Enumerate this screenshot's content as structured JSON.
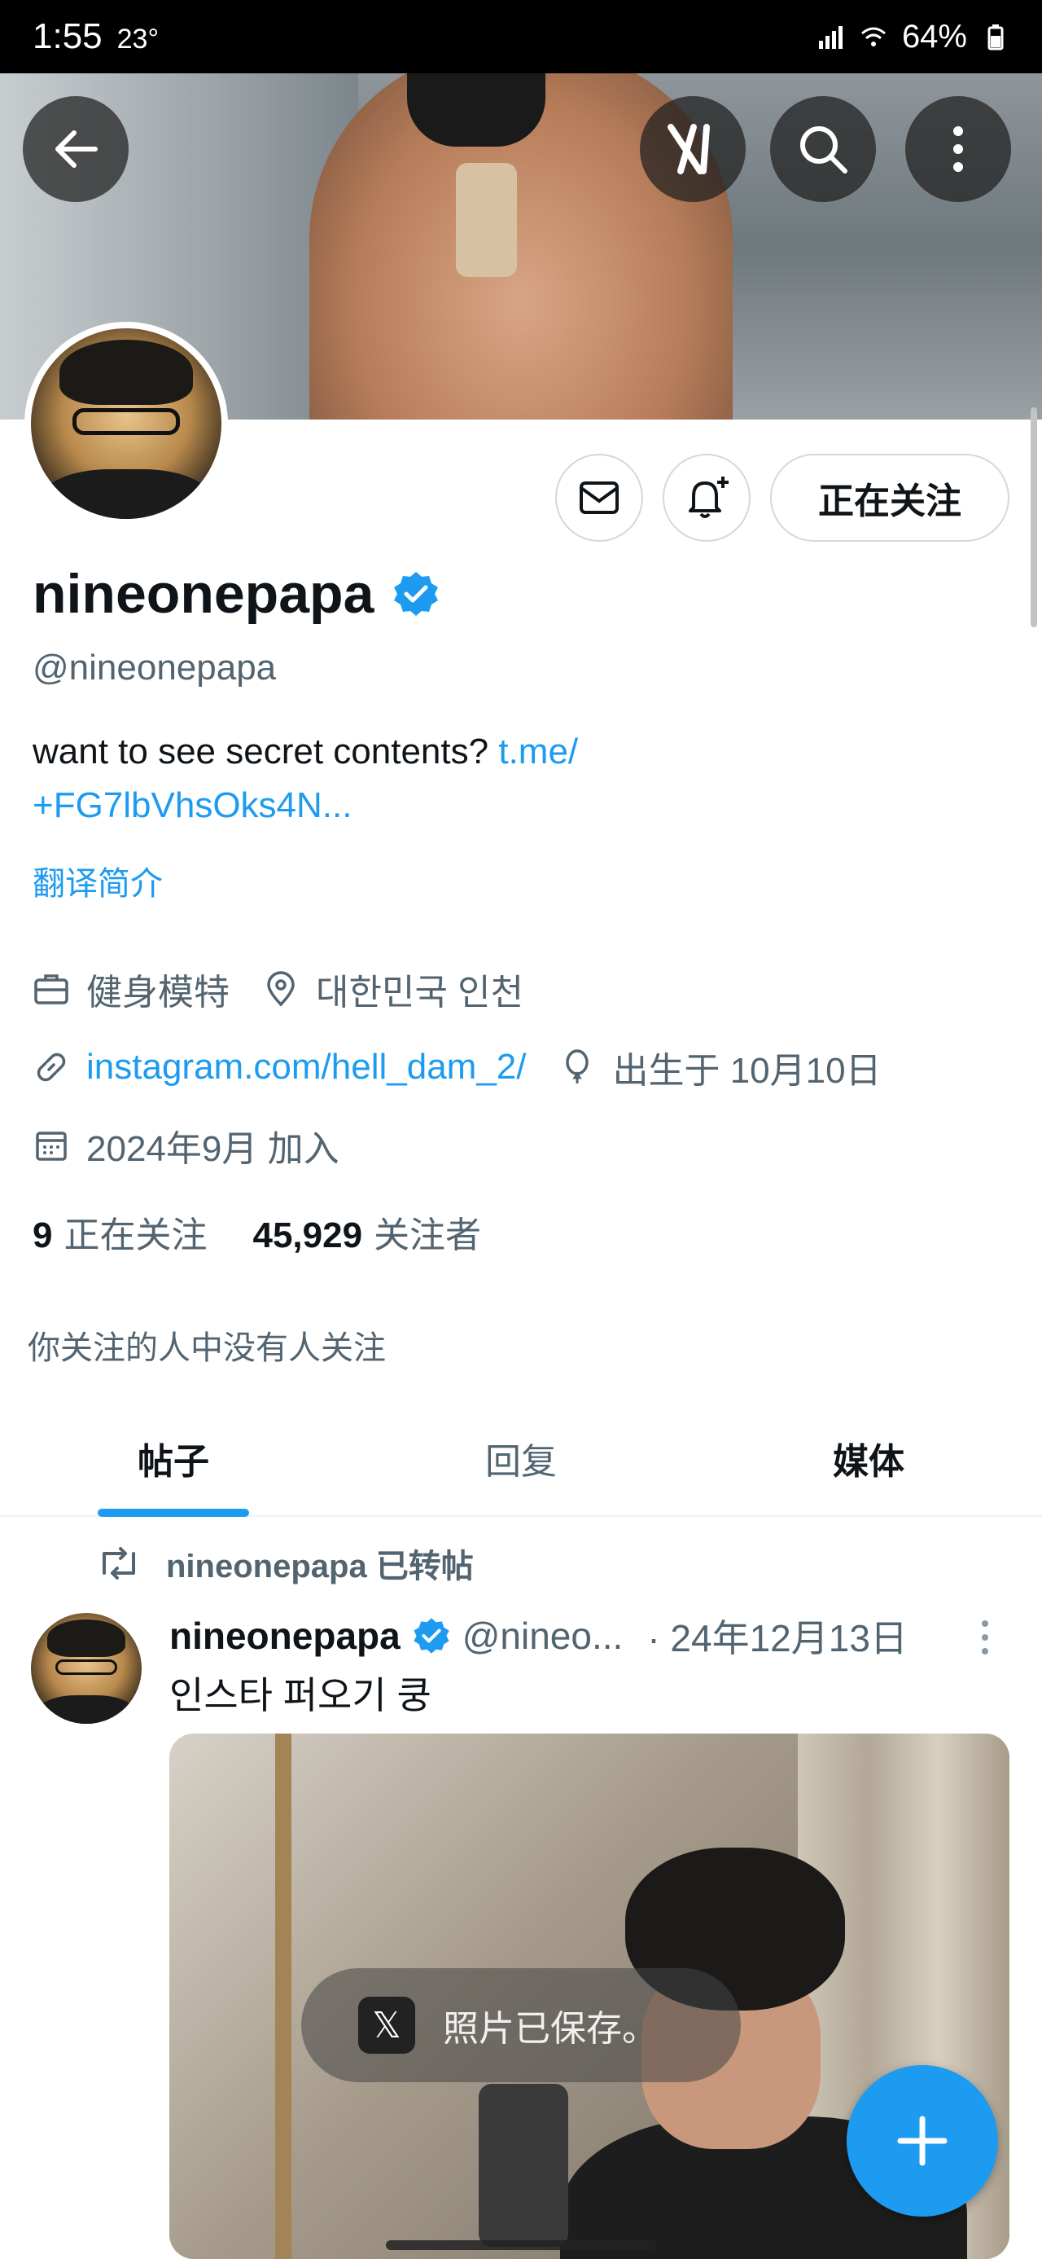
{
  "status_bar": {
    "time": "1:55",
    "temp": "23°",
    "battery": "64%"
  },
  "header": {
    "icons": [
      "back-arrow-icon",
      "grok-icon",
      "search-icon",
      "more-vertical-icon"
    ]
  },
  "actions": {
    "follow_label": "正在关注"
  },
  "profile": {
    "name": "nineonepapa",
    "handle": "@nineonepapa",
    "bio_text": "want to see secret contents?",
    "bio_link_1": "t.me/",
    "bio_link_2": "+FG7lbVhsOks4N...",
    "translate": "翻译简介",
    "category": "健身模特",
    "location": "대한민국 인천",
    "website": "instagram.com/hell_dam_2/",
    "birthday": "出生于 10月10日",
    "joined": "2024年9月 加入",
    "following_count": "9",
    "following_label": "正在关注",
    "followers_count": "45,929",
    "followers_label": "关注者",
    "followed_by": "你关注的人中没有人关注"
  },
  "tabs": [
    {
      "label": "帖子"
    },
    {
      "label": "回复"
    },
    {
      "label": "媒体"
    }
  ],
  "post": {
    "repost_label": "nineonepapa 已转帖",
    "author": "nineonepapa",
    "handle": "@nineo...",
    "date": "· 24年12月13日",
    "text": "인스타 퍼오기 쿵"
  },
  "toast": {
    "text": "照片已保存。"
  },
  "colors": {
    "accent": "#1d9bf0",
    "text": "#0f1419",
    "secondary": "#536471"
  }
}
